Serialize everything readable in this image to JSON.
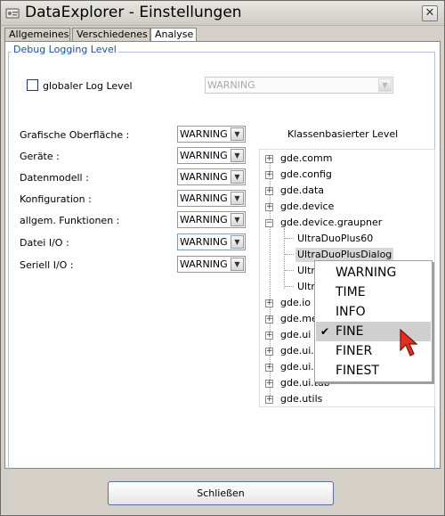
{
  "window": {
    "title": "DataExplorer - Einstellungen",
    "close_glyph": "✕"
  },
  "tabs": [
    {
      "label": "Allgemeines"
    },
    {
      "label": "Verschiedenes"
    },
    {
      "label": "Analyse"
    }
  ],
  "group": {
    "title": "Debug Logging Level"
  },
  "global": {
    "label": "globaler Log Level",
    "checked": false,
    "value": "WARNING"
  },
  "rows": [
    {
      "label": "Grafische Oberfläche :",
      "value": "WARNING"
    },
    {
      "label": "Geräte :",
      "value": "WARNING"
    },
    {
      "label": "Datenmodell :",
      "value": "WARNING"
    },
    {
      "label": "Konfiguration :",
      "value": "WARNING"
    },
    {
      "label": "allgem. Funktionen :",
      "value": "WARNING"
    },
    {
      "label": "Datei I/O :",
      "value": "WARNING"
    },
    {
      "label": "Seriell I/O :",
      "value": "WARNING"
    }
  ],
  "tree": {
    "header": "Klassenbasierter Level",
    "nodes": [
      {
        "label": "gde.comm"
      },
      {
        "label": "gde.config"
      },
      {
        "label": "gde.data"
      },
      {
        "label": "gde.device"
      },
      {
        "label": "gde.device.graupner"
      },
      {
        "label": "UltraDuoPlus60"
      },
      {
        "label": "UltraDuoPlusDialog"
      },
      {
        "label": "Ultr"
      },
      {
        "label": "Ultr"
      },
      {
        "label": "gde.io"
      },
      {
        "label": "gde.me"
      },
      {
        "label": "gde.ui"
      },
      {
        "label": "gde.ui."
      },
      {
        "label": "gde.ui."
      },
      {
        "label": "gde.ui.tab"
      },
      {
        "label": "gde.utils"
      }
    ]
  },
  "context_menu": {
    "items": [
      {
        "label": "WARNING"
      },
      {
        "label": "TIME"
      },
      {
        "label": "INFO"
      },
      {
        "label": "FINE",
        "checked": true,
        "check_glyph": "✔"
      },
      {
        "label": "FINER"
      },
      {
        "label": "FINEST"
      }
    ]
  },
  "footer": {
    "close_label": "Schließen"
  },
  "icons": {
    "dropdown_arrow": "▼",
    "expand": "+",
    "collapse": "−"
  },
  "colors": {
    "group_title": "#1f4fa0",
    "cursor": "#e03020",
    "selection": "#d8d8d8"
  }
}
